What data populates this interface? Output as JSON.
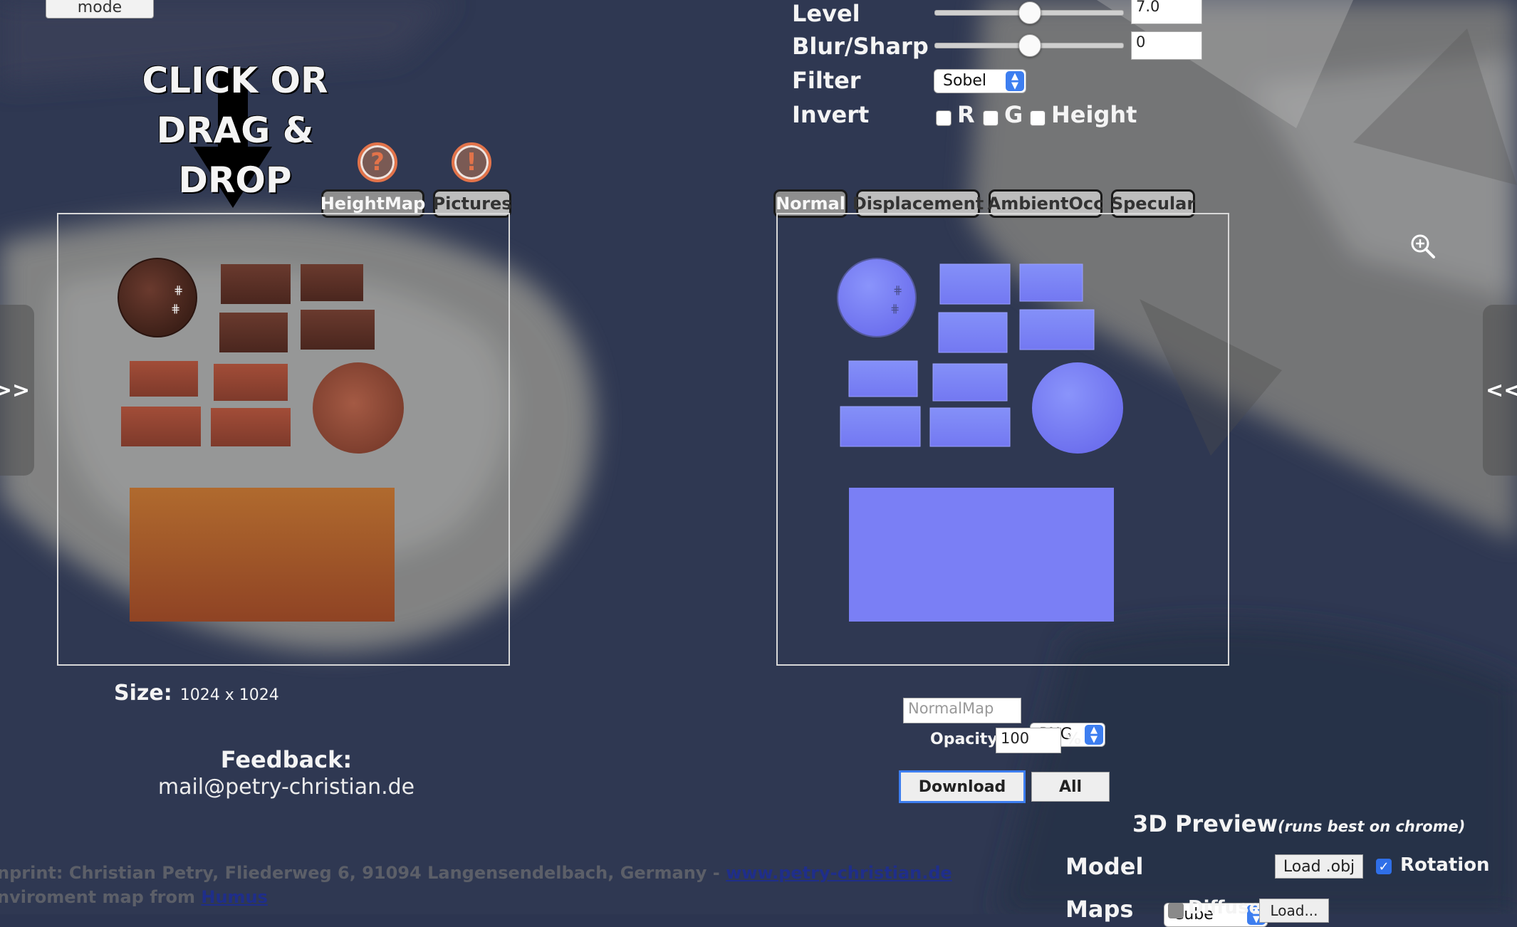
{
  "batch_mode": {
    "label": "Batch\nmode"
  },
  "dropzone": {
    "line1": "CLICK OR",
    "line2": "DRAG & DROP"
  },
  "help_icons": {
    "help": "?",
    "warning": "!"
  },
  "left_tabs": [
    {
      "label": "HeightMap"
    },
    {
      "label": "Pictures"
    }
  ],
  "right_tabs": [
    {
      "label": "Normal"
    },
    {
      "label": "Displacement"
    },
    {
      "label": "AmbientOcc"
    },
    {
      "label": "Specular"
    }
  ],
  "settings": {
    "level": {
      "label": "Level",
      "value": "7.0",
      "fraction": 0.5
    },
    "blur": {
      "label": "Blur/Sharp",
      "value": "0",
      "fraction": 0.5
    },
    "filter": {
      "label": "Filter",
      "value": "Sobel"
    },
    "invert": {
      "label": "Invert",
      "r": "R",
      "g": "G",
      "height": "Height"
    }
  },
  "size": {
    "label": "Size:",
    "value": "1024 x 1024"
  },
  "feedback": {
    "label": "Feedback:",
    "email": "mail@petry-christian.de"
  },
  "export": {
    "filename_placeholder": "NormalMap",
    "format": "PNG",
    "opacity_label": "Opacity",
    "opacity_value": "100",
    "percent": "%",
    "download": "Download",
    "all": "All"
  },
  "preview": {
    "title": "3D Preview",
    "subtitle": "(runs best on chrome)",
    "model_label": "Model",
    "model_value": "Cube",
    "load_obj": "Load .obj",
    "rotation": "Rotation",
    "maps_label": "Maps",
    "diffuse": "Diffuse",
    "load": "Load..."
  },
  "side": {
    "left": ">>",
    "right": "<<"
  },
  "footer": {
    "imprint": "nprint: Christian Petry, Fliederweg 6, 91094 Langensendelbach, Germany - ",
    "imprint_link": "www.petry-christian.de",
    "env": "nviroment map from ",
    "env_link": "Humus"
  },
  "colors": {
    "accent": "#3d7ef0",
    "tab_active": "#8e8e8e",
    "tab_inactive": "#bdbdbd",
    "normal_map": "#7a7ff5",
    "height_map": "#8a4a36"
  },
  "icons": [
    "question-icon",
    "warning-icon",
    "zoom-in-icon",
    "down-arrow-icon",
    "checkmark-icon"
  ]
}
